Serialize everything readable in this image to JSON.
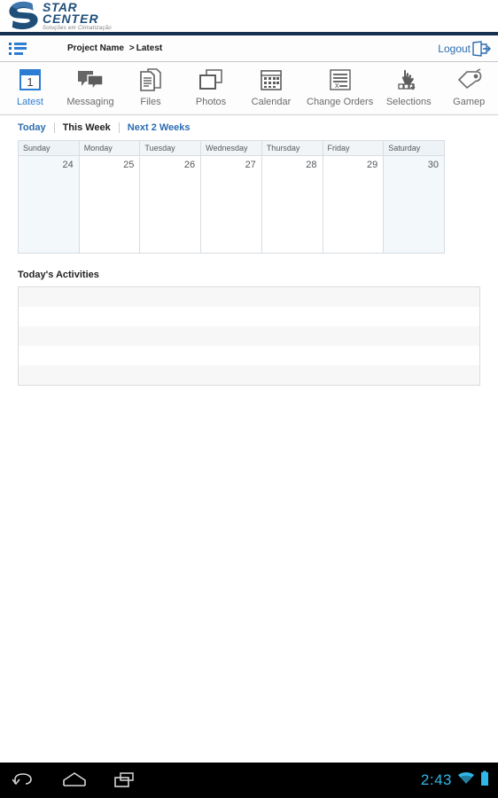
{
  "brand": {
    "line1": "STAR",
    "line2": "CENTER",
    "tagline": "Soluções em Climatização",
    "logo_blue": "#1f4e79"
  },
  "project_bar": {
    "menu_icon": "hamburger-list-icon",
    "project_label": "Project Name",
    "separator": ">",
    "current_page": "Latest",
    "logout_label": "Logout",
    "logout_icon": "exit-door-icon",
    "link_color": "#2b6cb0"
  },
  "toolbar": {
    "active_color": "#2b7cd3",
    "items": [
      {
        "label": "Latest",
        "icon": "calendar-day-one-icon",
        "active": true
      },
      {
        "label": "Messaging",
        "icon": "speech-bubbles-icon",
        "active": false
      },
      {
        "label": "Files",
        "icon": "documents-stack-icon",
        "active": false
      },
      {
        "label": "Photos",
        "icon": "photo-frames-icon",
        "active": false
      },
      {
        "label": "Calendar",
        "icon": "calendar-grid-icon",
        "active": false
      },
      {
        "label": "Change Orders",
        "icon": "checklist-lines-icon",
        "active": false
      },
      {
        "label": "Selections",
        "icon": "hand-pointer-icon",
        "active": false
      },
      {
        "label": "Gamep",
        "icon": "whistle-icon",
        "active": false
      }
    ]
  },
  "subtabs": [
    {
      "label": "Today",
      "active": false
    },
    {
      "label": "This Week",
      "active": true
    },
    {
      "label": "Next 2 Weeks",
      "active": false
    }
  ],
  "calendar": {
    "headers": [
      "Sunday",
      "Monday",
      "Tuesday",
      "Wednesday",
      "Thursday",
      "Friday",
      "Saturday"
    ],
    "days": [
      "24",
      "25",
      "26",
      "27",
      "28",
      "29",
      "30"
    ],
    "weekend_indexes": [
      0,
      6
    ],
    "weekend_header_color": "#eef3f8",
    "weekend_cell_color": "#f3f8fb"
  },
  "activities": {
    "title": "Today's Activities",
    "rows": [
      "",
      "",
      "",
      "",
      ""
    ]
  },
  "android_nav": {
    "back_icon": "back-arrow-icon",
    "home_icon": "home-icon",
    "recents_icon": "recent-apps-icon",
    "clock": "2:43",
    "wifi_icon": "wifi-icon",
    "battery_icon": "battery-full-icon",
    "accent_color": "#2fb8e8"
  }
}
